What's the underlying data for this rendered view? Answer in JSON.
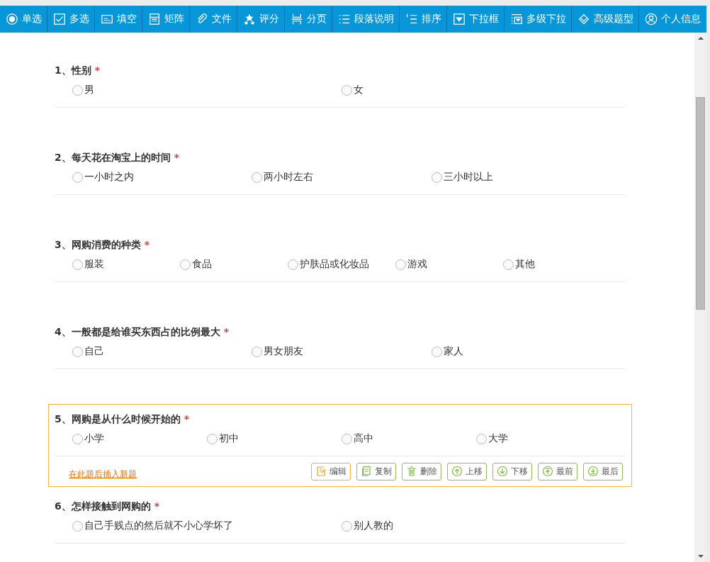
{
  "toolbar": [
    {
      "label": "单选"
    },
    {
      "label": "多选"
    },
    {
      "label": "填空"
    },
    {
      "label": "矩阵"
    },
    {
      "label": "文件"
    },
    {
      "label": "评分"
    },
    {
      "label": "分页"
    },
    {
      "label": "段落说明"
    },
    {
      "label": "排序"
    },
    {
      "label": "下拉框"
    },
    {
      "label": "多级下拉"
    },
    {
      "label": "高级题型"
    },
    {
      "label": "个人信息"
    }
  ],
  "questions": [
    {
      "number": "1、",
      "title": "性别",
      "required": true,
      "active": false,
      "options": [
        "男",
        "女"
      ]
    },
    {
      "number": "2、",
      "title": "每天花在淘宝上的时间",
      "required": true,
      "active": false,
      "options": [
        "一小时之内",
        "两小时左右",
        "三小时以上"
      ]
    },
    {
      "number": "3、",
      "title": "网购消费的种类",
      "required": true,
      "active": false,
      "options": [
        "服装",
        "食品",
        "护肤品或化妆品",
        "游戏",
        "其他"
      ]
    },
    {
      "number": "4、",
      "title": "一般都是给谁买东西占的比例最大",
      "required": true,
      "active": false,
      "options": [
        "自己",
        "男女朋友",
        "家人"
      ]
    },
    {
      "number": "5、",
      "title": "网购是从什么时候开始的",
      "required": true,
      "active": true,
      "options": [
        "小学",
        "初中",
        "高中",
        "大学"
      ]
    },
    {
      "number": "6、",
      "title": "怎样接触到网购的",
      "required": true,
      "active": false,
      "options": [
        "自己手贱点的然后就不小心学坏了",
        "别人教的"
      ]
    }
  ],
  "required_mark": "*",
  "insert_link": "在此题后插入新题",
  "actions": [
    {
      "label": "编辑",
      "highlighted": true
    },
    {
      "label": "复制",
      "highlighted": false
    },
    {
      "label": "删除",
      "highlighted": false
    },
    {
      "label": "上移",
      "highlighted": false
    },
    {
      "label": "下移",
      "highlighted": false
    },
    {
      "label": "最前",
      "highlighted": false
    },
    {
      "label": "最后",
      "highlighted": false
    }
  ]
}
